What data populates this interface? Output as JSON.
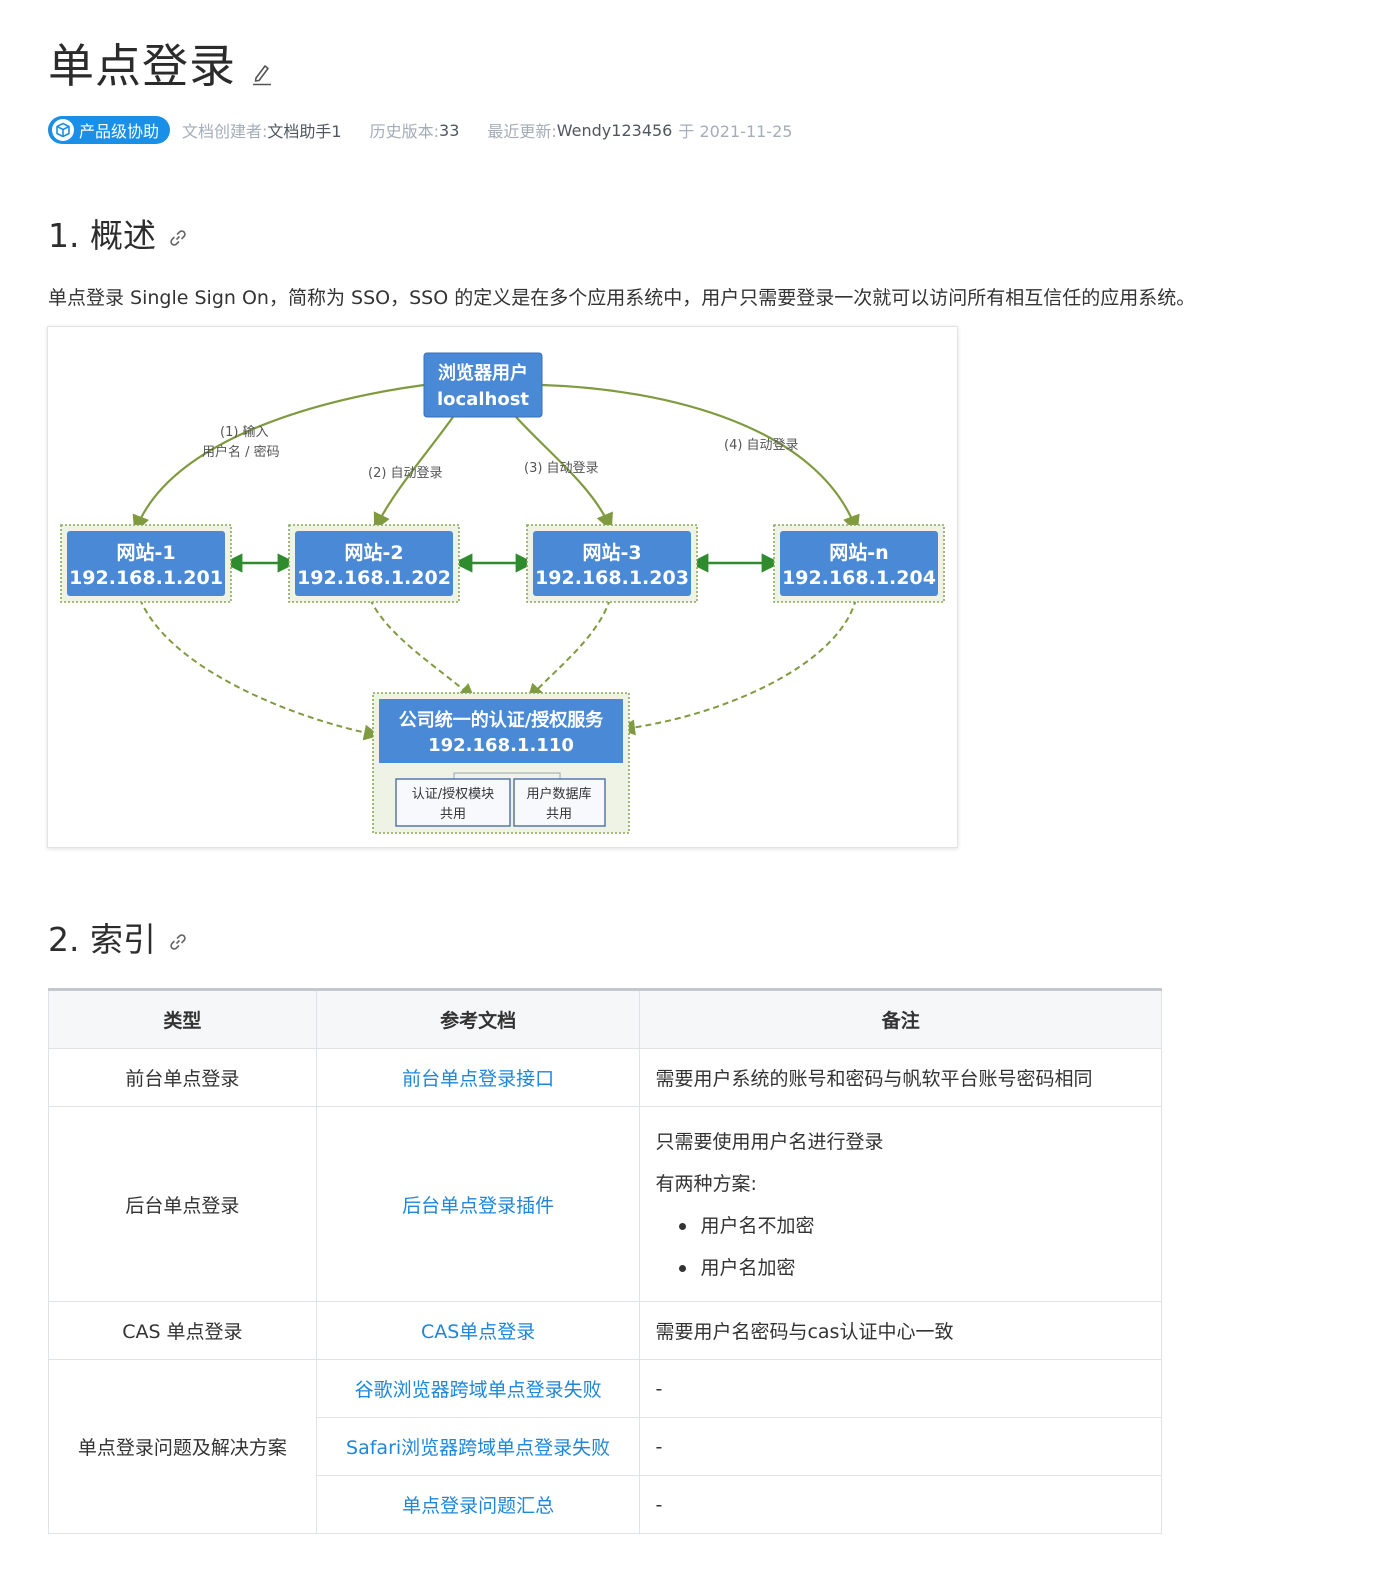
{
  "page": {
    "title": "单点登录",
    "edit_icon": "pencil-icon"
  },
  "meta": {
    "badge": "产品级协助",
    "badge_icon": "cube-icon",
    "creator_label": "文档创建者:",
    "creator": "文档助手1",
    "version_label": "历史版本:",
    "version": "33",
    "updated_label": "最近更新:",
    "updated_by": "Wendy123456",
    "updated_on": "于 2021-11-25"
  },
  "sections": [
    {
      "title": "1. 概述",
      "anchor_icon": "link-icon"
    },
    {
      "title": "2. 索引",
      "anchor_icon": "link-icon"
    }
  ],
  "overview": {
    "text": "单点登录 Single Sign On，简称为 SSO，SSO 的定义是在多个应用系统中，用户只需要登录一次就可以访问所有相互信任的应用系统。"
  },
  "diagram": {
    "user_node": [
      "浏览器用户",
      "localhost"
    ],
    "sites": [
      {
        "name": "网站-1",
        "ip": "192.168.1.201"
      },
      {
        "name": "网站-2",
        "ip": "192.168.1.202"
      },
      {
        "name": "网站-3",
        "ip": "192.168.1.203"
      },
      {
        "name": "网站-n",
        "ip": "192.168.1.204"
      }
    ],
    "edge_labels": {
      "e1_line1": "(1) 输入",
      "e1_line2": "用户名 / 密码",
      "e2": "(2) 自动登录",
      "e3": "(3) 自动登录",
      "e4": "(4) 自动登录"
    },
    "auth_node": [
      "公司统一的认证/授权服务",
      "192.168.1.110"
    ],
    "sub_modules": [
      [
        "认证/授权模块",
        "共用"
      ],
      [
        "用户数据库",
        "共用"
      ]
    ]
  },
  "index_table": {
    "headers": [
      "类型",
      "参考文档",
      "备注"
    ],
    "rows": [
      {
        "type": "前台单点登录",
        "doc": "前台单点登录接口",
        "note": "需要用户系统的账号和密码与帆软平台账号密码相同"
      },
      {
        "type": "后台单点登录",
        "doc": "后台单点登录插件",
        "note_lines": [
          "只需要使用用户名进行登录",
          "有两种方案:"
        ],
        "note_items": [
          "用户名不加密",
          "用户名加密"
        ]
      },
      {
        "type": "CAS 单点登录",
        "doc": "CAS单点登录",
        "note": "需要用户名密码与cas认证中心一致"
      },
      {
        "type": "单点登录问题及解决方案",
        "docs": [
          {
            "doc": "谷歌浏览器跨域单点登录失败",
            "note": "-"
          },
          {
            "doc": "Safari浏览器跨域单点登录失败",
            "note": "-"
          },
          {
            "doc": "单点登录问题汇总",
            "note": "-"
          }
        ]
      }
    ]
  },
  "colors": {
    "link": "#1f86d9",
    "badge": "#1a8fe8",
    "node_fill": "#4a89d6",
    "edge": "#7f9a3f",
    "site_arrow": "#2e8b2e"
  }
}
